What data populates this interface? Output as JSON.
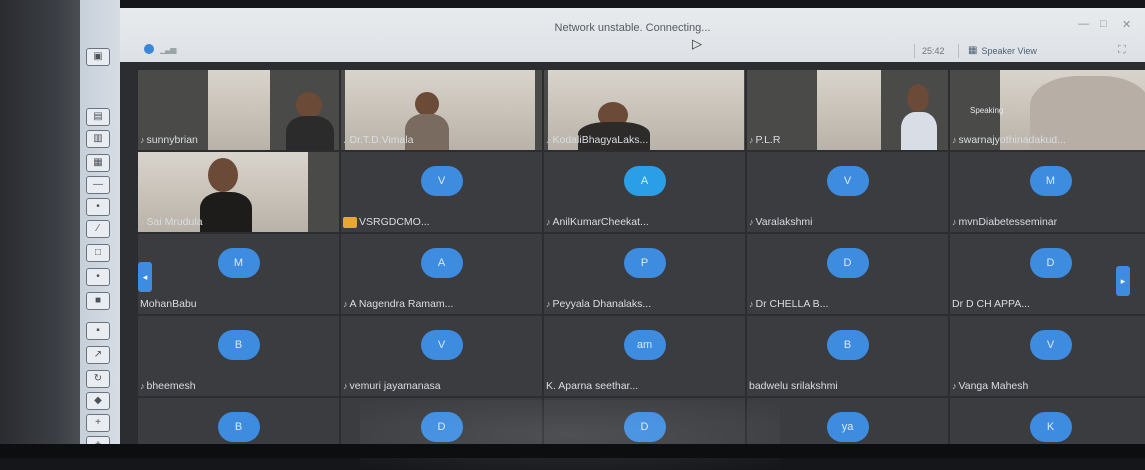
{
  "window": {
    "status_title": "Network unstable. Connecting...",
    "timer": "25:42",
    "view_button_label": "Speaker View"
  },
  "participants": [
    {
      "name": "sunnybrian",
      "type": "video",
      "mic": true
    },
    {
      "name": "Dr.T.D.Vimala",
      "type": "video",
      "mic": true
    },
    {
      "name": "KodaliBhagyaLaks...",
      "type": "video",
      "mic": true
    },
    {
      "name": "P.L.R",
      "type": "video",
      "mic": true
    },
    {
      "name": "swarnajyothinadakud...",
      "type": "video",
      "mic": true,
      "badge": "Speaking"
    },
    {
      "name": "Sai Mrudula",
      "type": "video",
      "mic": true
    },
    {
      "name": "VSRGDCMO...",
      "type": "avatar",
      "initial": "V",
      "mic": false
    },
    {
      "name": "AnilKumarCheekat...",
      "type": "avatar",
      "initial": "A",
      "mic": true
    },
    {
      "name": "Varalakshmi",
      "type": "avatar",
      "initial": "V",
      "mic": true
    },
    {
      "name": "mvnDiabetesseminar",
      "type": "avatar",
      "initial": "M",
      "mic": true
    },
    {
      "name": "MohanBabu",
      "type": "avatar",
      "initial": "M",
      "mic": false
    },
    {
      "name": "A Nagendra Ramam...",
      "type": "avatar",
      "initial": "A",
      "mic": true
    },
    {
      "name": "Peyyala Dhanalaks...",
      "type": "avatar",
      "initial": "P",
      "mic": true
    },
    {
      "name": "Dr CHELLA B...",
      "type": "avatar",
      "initial": "D",
      "mic": true
    },
    {
      "name": "Dr D CH APPA...",
      "type": "avatar",
      "initial": "D",
      "mic": false
    },
    {
      "name": "bheemesh",
      "type": "avatar",
      "initial": "B",
      "mic": true
    },
    {
      "name": "vemuri jayamanasa",
      "type": "avatar",
      "initial": "V",
      "mic": true
    },
    {
      "name": "K. Aparna seethar...",
      "type": "avatar",
      "initial": "am",
      "mic": false
    },
    {
      "name": "badwelu srilakshmi",
      "type": "avatar",
      "initial": "B",
      "mic": false
    },
    {
      "name": "Vanga Mahesh",
      "type": "avatar",
      "initial": "V",
      "mic": true
    },
    {
      "name": "",
      "type": "avatar",
      "initial": "B",
      "mic": false
    },
    {
      "name": "",
      "type": "avatar",
      "initial": "D",
      "mic": false
    },
    {
      "name": "",
      "type": "avatar",
      "initial": "D",
      "mic": false
    },
    {
      "name": "",
      "type": "avatar",
      "initial": "ya",
      "mic": false
    },
    {
      "name": "",
      "type": "avatar",
      "initial": "K",
      "mic": false
    }
  ],
  "colors": {
    "avatar_blue": "#3d8ce0",
    "titlebar": "#e4e7ea",
    "tile_bg": "#3a3c40"
  },
  "icons": {
    "mic": "mic-icon",
    "view": "grid-icon",
    "connection": "signal-bars-icon"
  }
}
